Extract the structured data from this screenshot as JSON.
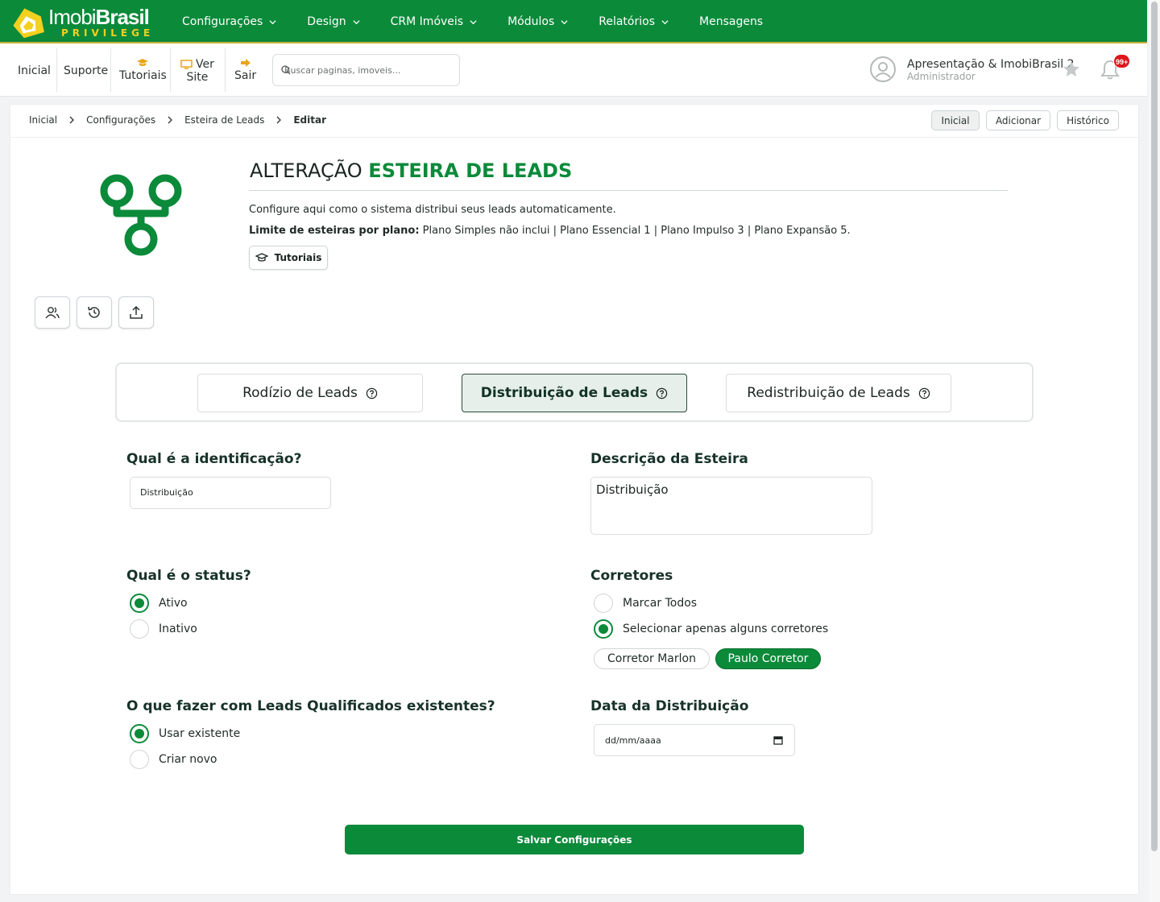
{
  "brand": {
    "name_light": "Imobi",
    "name_bold": "Brasil",
    "tagline": "PRIVILEGE",
    "logo_icon": "house-logo-icon",
    "accent_color": "#0b8a3a"
  },
  "nav": {
    "items": [
      {
        "label": "Configurações"
      },
      {
        "label": "Design"
      },
      {
        "label": "CRM Imóveis"
      },
      {
        "label": "Módulos"
      },
      {
        "label": "Relatórios"
      },
      {
        "label": "Mensagens"
      }
    ]
  },
  "subbar": {
    "inicial": "Inicial",
    "suporte": "Suporte",
    "tutoriais": "Tutoriais",
    "ver_site_1": "Ver",
    "ver_site_2": "Site",
    "sair": "Sair",
    "search_placeholder": "Buscar paginas, imoveis...",
    "user_name": "Apresentação & ImobiBrasil 2",
    "user_role": "Administrador",
    "notification_count": "99+"
  },
  "breadcrumb": {
    "items": [
      "Inicial",
      "Configurações",
      "Esteira de Leads",
      "Editar"
    ],
    "buttons": [
      "Inicial",
      "Adicionar",
      "Histórico"
    ]
  },
  "header": {
    "title_plain": "ALTERAÇÃO",
    "title_accent": "ESTEIRA DE LEADS",
    "description": "Configure aqui como o sistema distribui seus leads automaticamente.",
    "limits_label": "Limite de esteiras por plano:",
    "limits_text": " Plano Simples não inclui | Plano Essencial 1 | Plano Impulso 3 | Plano Expansão 5.",
    "tutorials_button": "Tutoriais"
  },
  "tabs": [
    {
      "label": "Rodízio de Leads",
      "active": false
    },
    {
      "label": "Distribuição de Leads",
      "active": true
    },
    {
      "label": "Redistribuição de Leads",
      "active": false
    }
  ],
  "form": {
    "identification_label": "Qual é a identificação?",
    "identification_value": "Distribuição",
    "description_label": "Descrição da Esteira",
    "description_value": "Distribuição",
    "status_label": "Qual é o status?",
    "status_options": [
      "Ativo",
      "Inativo"
    ],
    "status_selected": "Ativo",
    "brokers_label": "Corretores",
    "brokers_options": [
      "Marcar Todos",
      "Selecionar apenas alguns corretores"
    ],
    "brokers_selected": "Selecionar apenas alguns corretores",
    "broker_chips": [
      {
        "label": "Corretor Marlon",
        "selected": false
      },
      {
        "label": "Paulo Corretor",
        "selected": true
      }
    ],
    "qualified_label": "O que fazer com Leads Qualificados existentes?",
    "qualified_options": [
      "Usar existente",
      "Criar novo"
    ],
    "qualified_selected": "Usar existente",
    "date_label": "Data da Distribuição",
    "date_placeholder": "dd/mm/aaaa",
    "save_button": "Salvar Configurações"
  }
}
